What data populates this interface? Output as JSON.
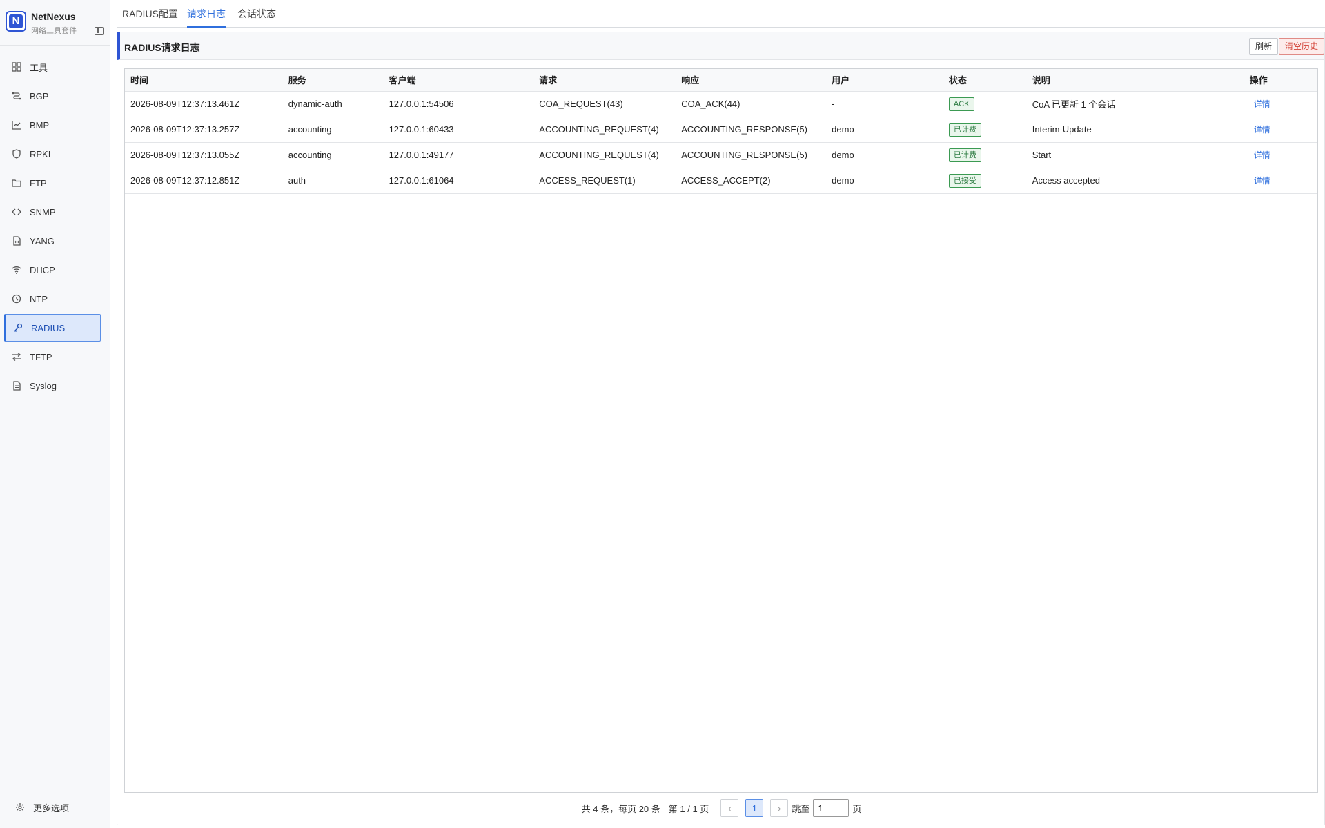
{
  "brand": {
    "name": "NetNexus",
    "subtitle": "网络工具套件",
    "logo_letter": "N"
  },
  "sidebar": {
    "items": [
      {
        "label": "工具",
        "icon": "grid-icon"
      },
      {
        "label": "BGP",
        "icon": "route-icon"
      },
      {
        "label": "BMP",
        "icon": "chart-icon"
      },
      {
        "label": "RPKI",
        "icon": "shield-icon"
      },
      {
        "label": "FTP",
        "icon": "folder-icon"
      },
      {
        "label": "SNMP",
        "icon": "code-icon"
      },
      {
        "label": "YANG",
        "icon": "file-code-icon"
      },
      {
        "label": "DHCP",
        "icon": "wifi-icon"
      },
      {
        "label": "NTP",
        "icon": "clock-icon"
      },
      {
        "label": "RADIUS",
        "icon": "key-icon",
        "active": true
      },
      {
        "label": "TFTP",
        "icon": "transfer-icon"
      },
      {
        "label": "Syslog",
        "icon": "document-icon"
      }
    ],
    "more_options": "更多选项"
  },
  "tabs": [
    {
      "label": "RADIUS配置"
    },
    {
      "label": "请求日志",
      "active": true
    },
    {
      "label": "会话状态"
    }
  ],
  "panel": {
    "title": "RADIUS请求日志",
    "refresh_label": "刷新",
    "clear_label": "清空历史"
  },
  "table": {
    "columns": [
      "时间",
      "服务",
      "客户端",
      "请求",
      "响应",
      "用户",
      "状态",
      "说明",
      "操作"
    ],
    "rows": [
      {
        "time": "2026-08-09T12:37:13.461Z",
        "service": "dynamic-auth",
        "client": "127.0.0.1:54506",
        "request": "COA_REQUEST(43)",
        "response": "COA_ACK(44)",
        "user": "-",
        "status": "ACK",
        "desc": "CoA 已更新 1 个会话",
        "action": "详情"
      },
      {
        "time": "2026-08-09T12:37:13.257Z",
        "service": "accounting",
        "client": "127.0.0.1:60433",
        "request": "ACCOUNTING_REQUEST(4)",
        "response": "ACCOUNTING_RESPONSE(5)",
        "user": "demo",
        "status": "已计费",
        "desc": "Interim-Update",
        "action": "详情"
      },
      {
        "time": "2026-08-09T12:37:13.055Z",
        "service": "accounting",
        "client": "127.0.0.1:49177",
        "request": "ACCOUNTING_REQUEST(4)",
        "response": "ACCOUNTING_RESPONSE(5)",
        "user": "demo",
        "status": "已计费",
        "desc": "Start",
        "action": "详情"
      },
      {
        "time": "2026-08-09T12:37:12.851Z",
        "service": "auth",
        "client": "127.0.0.1:61064",
        "request": "ACCESS_REQUEST(1)",
        "response": "ACCESS_ACCEPT(2)",
        "user": "demo",
        "status": "已接受",
        "desc": "Access accepted",
        "action": "详情"
      }
    ]
  },
  "pagination": {
    "total_text": "共 4 条，每页 20 条",
    "page_text": "第 1 / 1 页",
    "prev": "‹",
    "current_page": "1",
    "next": "›",
    "jump_label": "跳至",
    "jump_value": "1",
    "page_suffix": "页"
  },
  "colors": {
    "accent": "#2f6fdd",
    "danger": "#d24034",
    "success": "#2d7c42"
  }
}
